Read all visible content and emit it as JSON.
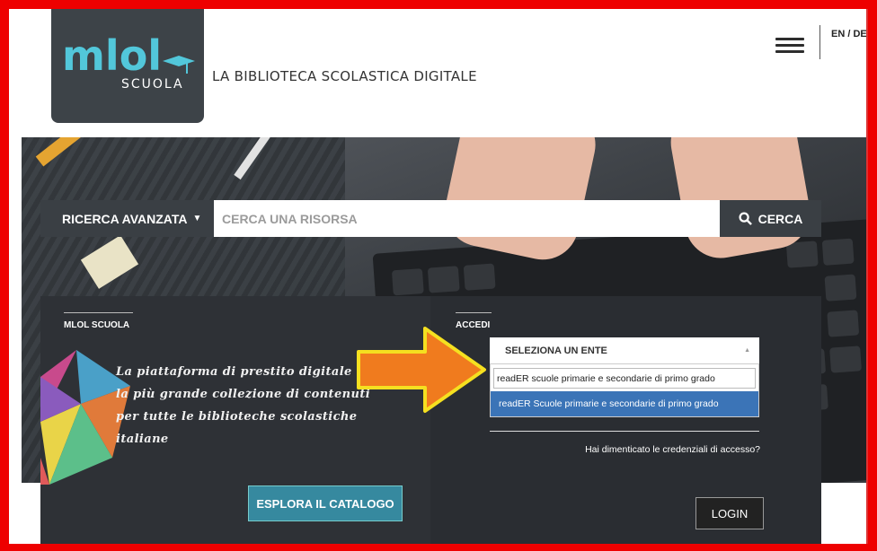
{
  "header": {
    "logo_main": "mlol",
    "logo_sub": "SCUOLA",
    "tagline": "LA BIBLIOTECA SCOLASTICA DIGITALE",
    "lang": "EN / DE"
  },
  "search": {
    "advanced_label": "RICERCA AVANZATA",
    "placeholder": "CERCA UNA RISORSA",
    "button_label": "CERCA"
  },
  "left_panel": {
    "title": "MLOL SCUOLA",
    "description_lines": [
      "La piattaforma di prestito digitale con",
      "la più grande collezione di contenuti",
      "per tutte le biblioteche scolastiche",
      "italiane"
    ],
    "explore_label": "ESPLORA IL CATALOGO"
  },
  "right_panel": {
    "title": "ACCEDI",
    "select_label": "SELEZIONA UN ENTE",
    "search_value": "readER scuole primarie e secondarie di primo grado",
    "option": "readER Scuole primarie e secondarie di primo grado",
    "forgot_label": "Hai dimenticato le credenziali di accesso?",
    "login_label": "LOGIN"
  },
  "colors": {
    "frame": "#ee0000",
    "panel_dark": "#2e3136",
    "accent_teal": "#36899f",
    "option_blue": "#3b74b7",
    "arrow_orange": "#f07b1e",
    "arrow_outline": "#f5e020"
  },
  "icons": {
    "menu": "hamburger-icon",
    "search": "magnifier-icon",
    "chevron": "chevron-down-icon",
    "caret": "caret-up-icon"
  }
}
